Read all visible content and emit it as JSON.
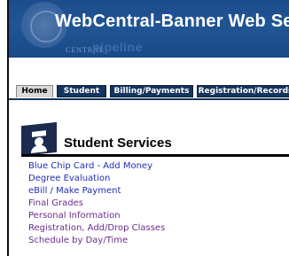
{
  "header": {
    "app_title": "WebCentral-Banner Web Serv",
    "logo_small": "CENTRAL",
    "logo_big": "pipeline"
  },
  "tabs": [
    {
      "label": "Home",
      "active": true
    },
    {
      "label": "Student",
      "active": false
    },
    {
      "label": "Billing/Payments",
      "active": false
    },
    {
      "label": "Registration/Records",
      "active": false
    }
  ],
  "section": {
    "title": "Student Services",
    "icon": "student-services-icon"
  },
  "links": [
    {
      "label": "Blue Chip Card - Add Money",
      "visited": false
    },
    {
      "label": "Degree Evaluation",
      "visited": false
    },
    {
      "label": "eBill / Make Payment",
      "visited": false
    },
    {
      "label": "Final Grades",
      "visited": true
    },
    {
      "label": "Personal Information",
      "visited": true
    },
    {
      "label": "Registration, Add/Drop Classes",
      "visited": true
    },
    {
      "label": "Schedule by Day/Time",
      "visited": true
    }
  ],
  "colors": {
    "banner": "#205595",
    "tab_dark": "#15345c",
    "link": "#1d2fb6",
    "link_visited": "#6a2c8a"
  }
}
